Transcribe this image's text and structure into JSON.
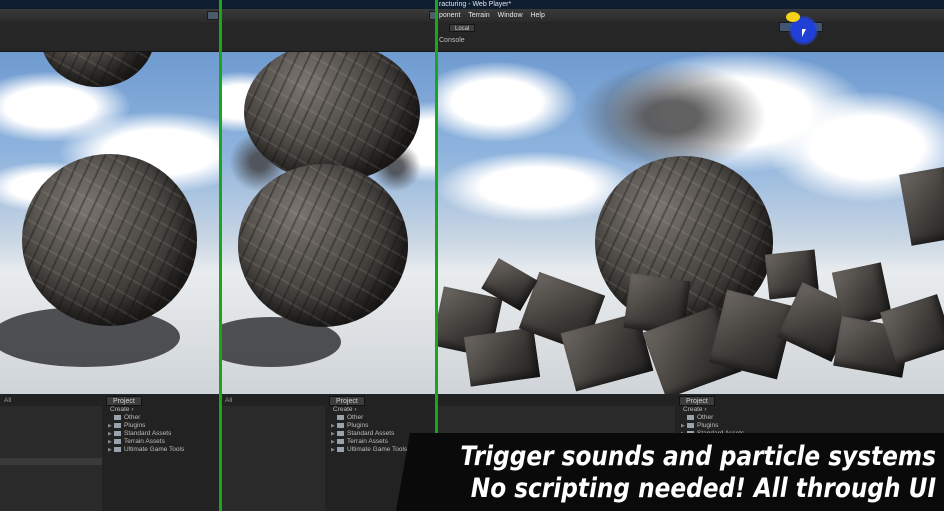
{
  "window": {
    "title": "racturing - Web Player*",
    "menu": [
      "ponent",
      "Terrain",
      "Window",
      "Help"
    ]
  },
  "toolbar": {
    "local_label": "Local",
    "console_label": "Console"
  },
  "project_panel": {
    "tab_label": "Project",
    "create_label": "Create ›",
    "all_label": "All",
    "folders": [
      "Other",
      "Plugins",
      "Standard Assets",
      "Terrain Assets",
      "Ultimate Game Tools"
    ]
  },
  "caption": {
    "line1": "Trigger sounds and particle systems",
    "line2": "No scripting needed! All through UI"
  },
  "colors": {
    "divider": "#1aa51a",
    "cursor_highlight": "#1f3fd6",
    "caption_bg": "#0a0a0a"
  }
}
